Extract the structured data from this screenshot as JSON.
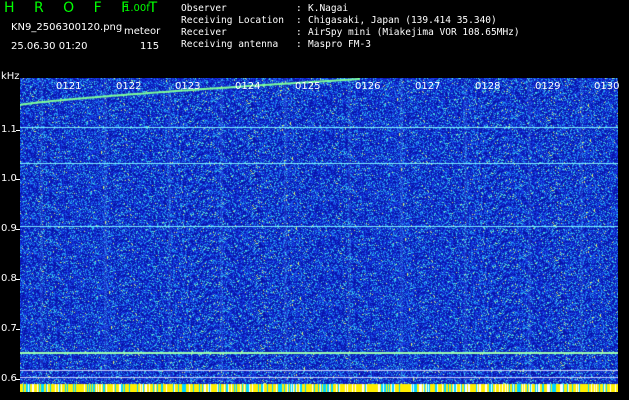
{
  "header": {
    "title": "H R O F F T",
    "version": "1.00f",
    "filename": "KN9_2506300120.png",
    "type": "meteor",
    "datetime": "25.06.30 01:20",
    "count": "115"
  },
  "info": [
    {
      "label": "Observer",
      "value": "K.Nagai"
    },
    {
      "label": "Receiving Location",
      "value": "Chigasaki, Japan (139.414 35.340)"
    },
    {
      "label": "Receiver",
      "value": "AirSpy mini (Miakejima VOR 108.65MHz)"
    },
    {
      "label": "Receiving antenna",
      "value": "Maspro FM-3"
    }
  ],
  "axis": {
    "unit": "kHz",
    "y_labels": [
      "1.1",
      "1.0",
      "0.9",
      "0.8",
      "0.7",
      "0.6"
    ],
    "x_labels": [
      "0121",
      "0122",
      "0123",
      "0124",
      "0125",
      "0126",
      "0127",
      "0128",
      "0129",
      "0130"
    ]
  },
  "colors": {
    "background": "#000000",
    "title": "#00ff00",
    "spectrogram_base": "#0a1ec8",
    "signal_lines": "#7ff0ff",
    "bottom_band": "#ffee00"
  }
}
